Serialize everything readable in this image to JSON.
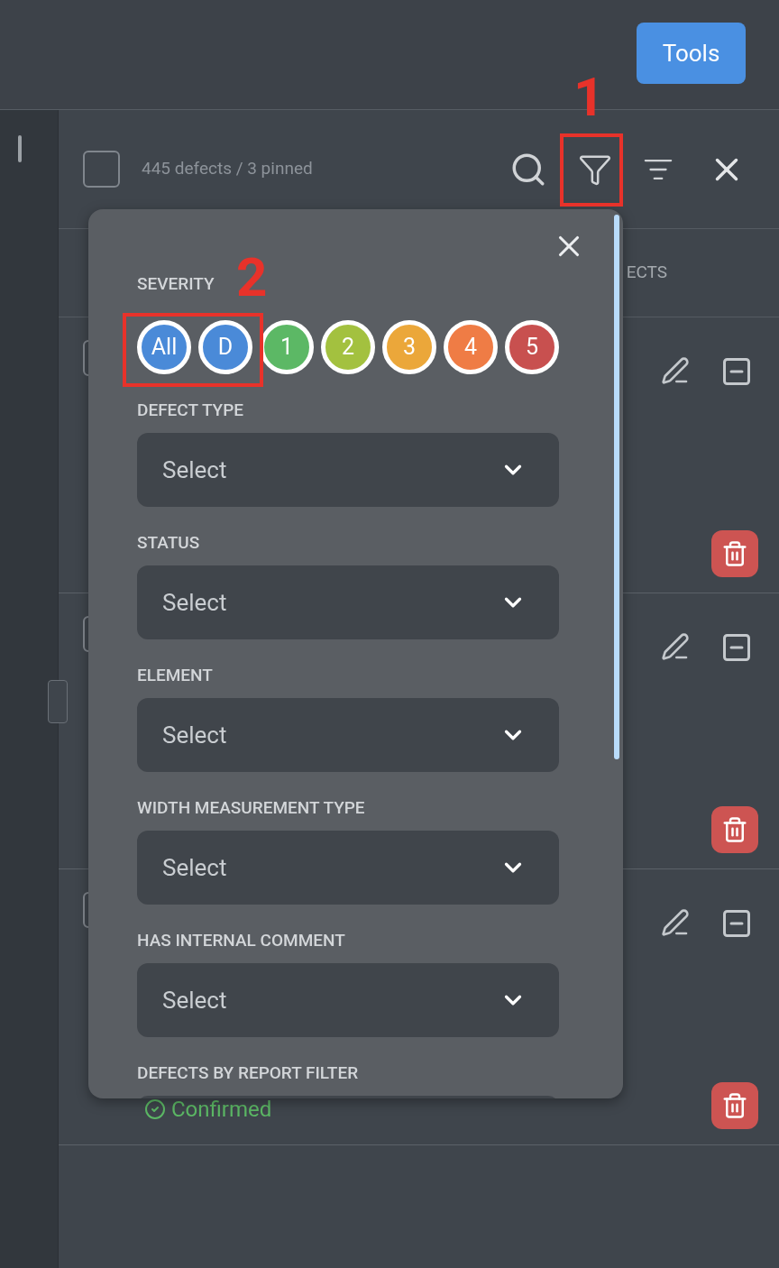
{
  "toolbar": {
    "tools_button": "Tools"
  },
  "list": {
    "select_all_checked": false,
    "count": "445 defects / 3 pinned",
    "column_header": "ECTS",
    "rows": [
      {
        "checked": false
      },
      {
        "checked": false
      },
      {
        "checked": false,
        "status": "Confirmed"
      }
    ]
  },
  "filter_panel": {
    "sections": [
      {
        "kind": "chips",
        "label": "SEVERITY",
        "chips": [
          {
            "label": "All",
            "color": "#4a8ad8"
          },
          {
            "label": "D",
            "color": "#4a8ad8"
          },
          {
            "label": "1",
            "color": "#5cb865"
          },
          {
            "label": "2",
            "color": "#a3c13f"
          },
          {
            "label": "3",
            "color": "#eba73a"
          },
          {
            "label": "4",
            "color": "#ef7c45"
          },
          {
            "label": "5",
            "color": "#c8504f"
          }
        ]
      },
      {
        "kind": "select",
        "label": "DEFECT TYPE",
        "placeholder": "Select"
      },
      {
        "kind": "select",
        "label": "STATUS",
        "placeholder": "Select"
      },
      {
        "kind": "select",
        "label": "ELEMENT",
        "placeholder": "Select"
      },
      {
        "kind": "select",
        "label": "WIDTH MEASUREMENT TYPE",
        "placeholder": "Select"
      },
      {
        "kind": "select",
        "label": "HAS INTERNAL COMMENT",
        "placeholder": "Select"
      },
      {
        "kind": "select",
        "label": "DEFECTS BY REPORT FILTER"
      }
    ]
  },
  "annotations": [
    {
      "label": "1"
    },
    {
      "label": "2"
    }
  ]
}
